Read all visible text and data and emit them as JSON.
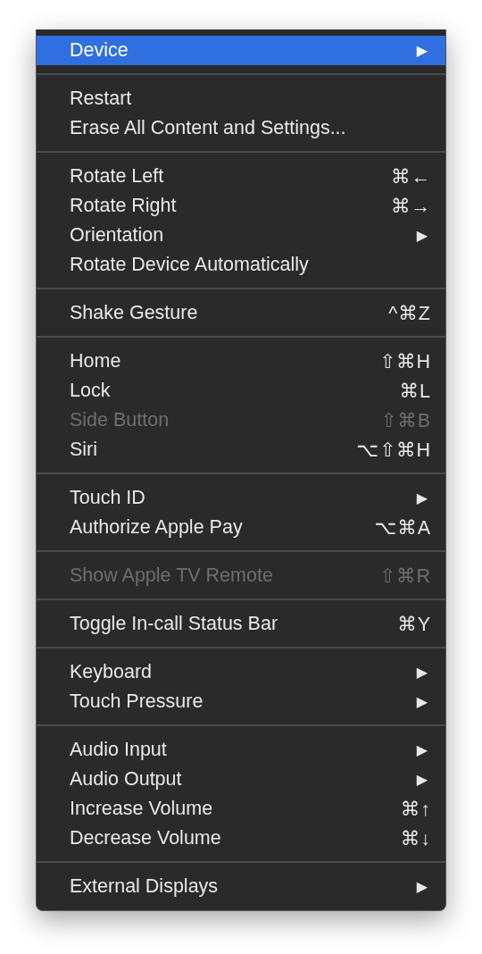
{
  "menu": {
    "sections": [
      {
        "items": [
          {
            "label": "Device",
            "arrow": "▶",
            "selected": true,
            "disabled": false
          }
        ]
      },
      {
        "items": [
          {
            "label": "Restart",
            "selected": false,
            "disabled": false
          },
          {
            "label": "Erase All Content and Settings...",
            "selected": false,
            "disabled": false
          }
        ]
      },
      {
        "items": [
          {
            "label": "Rotate Left",
            "shortcut": "⌘←",
            "selected": false,
            "disabled": false
          },
          {
            "label": "Rotate Right",
            "shortcut": "⌘→",
            "selected": false,
            "disabled": false
          },
          {
            "label": "Orientation",
            "arrow": "▶",
            "selected": false,
            "disabled": false
          },
          {
            "label": "Rotate Device Automatically",
            "selected": false,
            "disabled": false
          }
        ]
      },
      {
        "items": [
          {
            "label": "Shake Gesture",
            "shortcut": "^⌘Z",
            "selected": false,
            "disabled": false
          }
        ]
      },
      {
        "items": [
          {
            "label": "Home",
            "shortcut": "⇧⌘H",
            "selected": false,
            "disabled": false
          },
          {
            "label": "Lock",
            "shortcut": "⌘L",
            "selected": false,
            "disabled": false
          },
          {
            "label": "Side Button",
            "shortcut": "⇧⌘B",
            "selected": false,
            "disabled": true
          },
          {
            "label": "Siri",
            "shortcut": "⌥⇧⌘H",
            "selected": false,
            "disabled": false
          }
        ]
      },
      {
        "items": [
          {
            "label": "Touch ID",
            "arrow": "▶",
            "selected": false,
            "disabled": false
          },
          {
            "label": "Authorize Apple Pay",
            "shortcut": "⌥⌘A",
            "selected": false,
            "disabled": false
          }
        ]
      },
      {
        "items": [
          {
            "label": "Show Apple TV Remote",
            "shortcut": "⇧⌘R",
            "selected": false,
            "disabled": true
          }
        ]
      },
      {
        "items": [
          {
            "label": "Toggle In-call Status Bar",
            "shortcut": "⌘Y",
            "selected": false,
            "disabled": false
          }
        ]
      },
      {
        "items": [
          {
            "label": "Keyboard",
            "arrow": "▶",
            "selected": false,
            "disabled": false
          },
          {
            "label": "Touch Pressure",
            "arrow": "▶",
            "selected": false,
            "disabled": false
          }
        ]
      },
      {
        "items": [
          {
            "label": "Audio Input",
            "arrow": "▶",
            "selected": false,
            "disabled": false
          },
          {
            "label": "Audio Output",
            "arrow": "▶",
            "selected": false,
            "disabled": false
          },
          {
            "label": "Increase Volume",
            "shortcut": "⌘↑",
            "selected": false,
            "disabled": false
          },
          {
            "label": "Decrease Volume",
            "shortcut": "⌘↓",
            "selected": false,
            "disabled": false
          }
        ]
      },
      {
        "items": [
          {
            "label": "External Displays",
            "arrow": "▶",
            "selected": false,
            "disabled": false
          }
        ]
      }
    ]
  }
}
